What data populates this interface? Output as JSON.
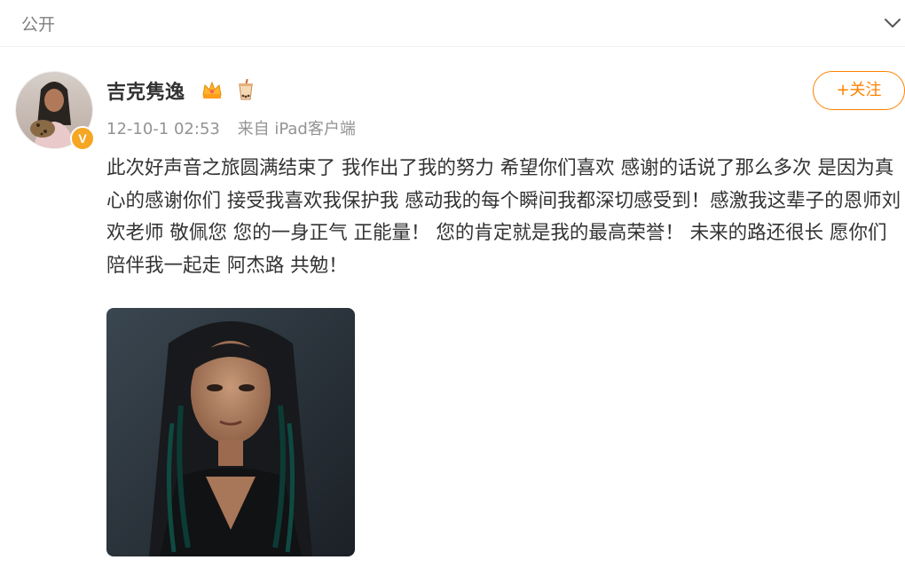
{
  "header": {
    "visibility_label": "公开",
    "collapse_icon": "chevron-down-icon"
  },
  "author": {
    "name": "吉克隽逸",
    "verified_badge": "V",
    "badges": [
      "crown-icon",
      "bubble-tea-icon"
    ]
  },
  "post": {
    "timestamp": "12-10-1 02:53",
    "source": "来自 iPad客户端",
    "text": "此次好声音之旅圆满结束了 我作出了我的努力 希望你们喜欢 感谢的话说了那么多次 是因为真心的感谢你们 接受我喜欢我保护我 感动我的每个瞬间我都深切感受到！感激我这辈子的恩师刘欢老师 敬佩您 您的一身正气 正能量！ 您的肯定就是我的最高荣誉！ 未来的路还很长 愿你们陪伴我一起走 阿杰路 共勉！"
  },
  "actions": {
    "follow_label": "+关注"
  },
  "colors": {
    "accent": "#ff8200",
    "meta_text": "#939393",
    "body_text": "#333333",
    "badge_orange": "#f5a623"
  }
}
